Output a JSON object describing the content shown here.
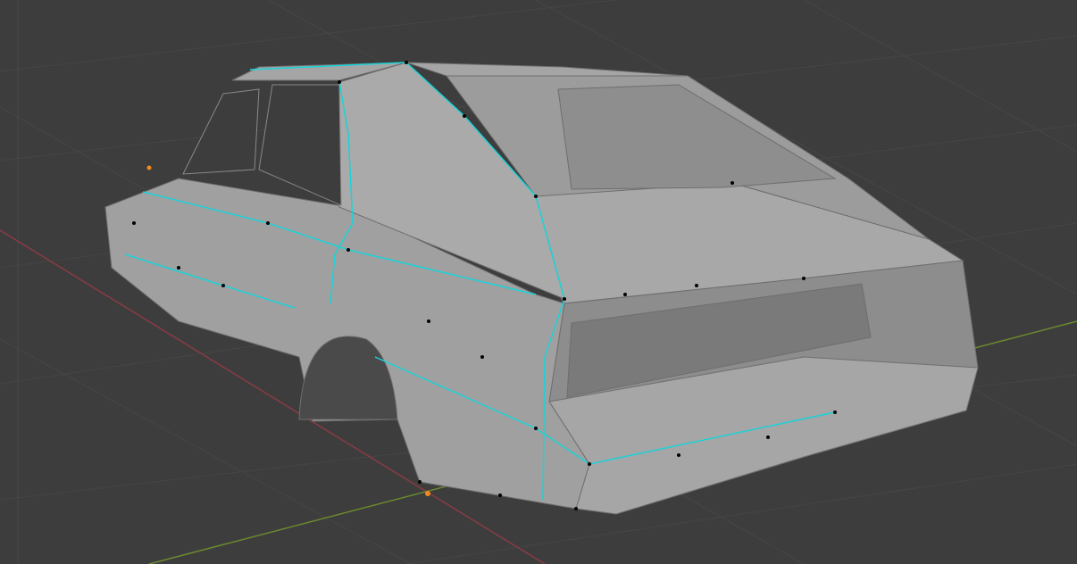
{
  "viewport": {
    "mode": "edit-mesh",
    "colors": {
      "background": "#3d3d3d",
      "grid": "#464646",
      "x_axis": "#8a3b45",
      "y_axis": "#6b8a2e",
      "mesh_face": "#a3a3a3",
      "seam_edge": "#19d3d8",
      "vertex": "#000000",
      "active_vertex": "#f08a1c"
    }
  }
}
